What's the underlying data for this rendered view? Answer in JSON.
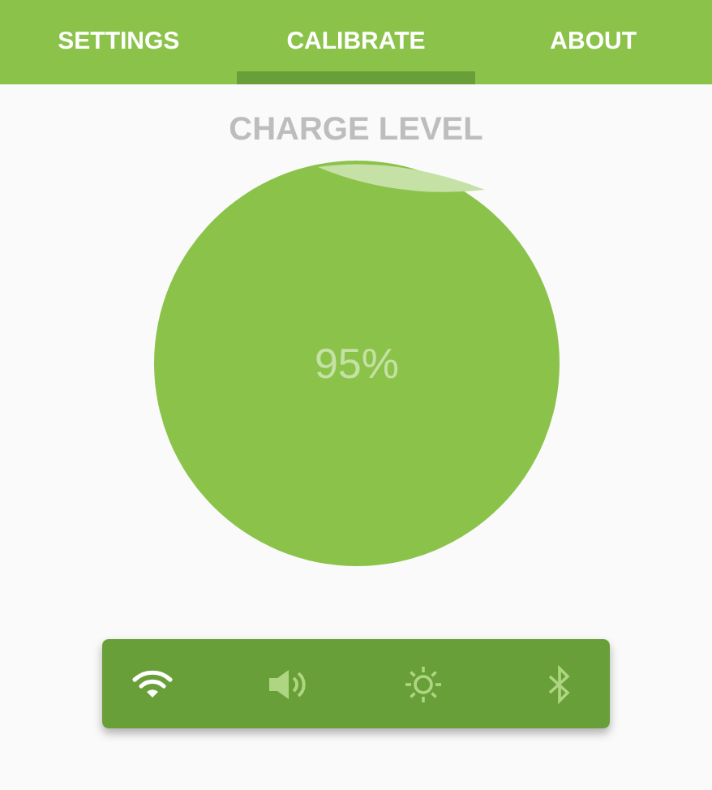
{
  "tabs": [
    {
      "label": "SETTINGS",
      "selected": false
    },
    {
      "label": "CALIBRATE",
      "selected": true
    },
    {
      "label": "ABOUT",
      "selected": false
    }
  ],
  "charge": {
    "title": "CHARGE LEVEL",
    "reading": "95%"
  },
  "toggles": [
    {
      "kind": "wifi",
      "on": true
    },
    {
      "kind": "sound",
      "on": false
    },
    {
      "kind": "brightness",
      "on": false
    },
    {
      "kind": "bluetooth",
      "on": false
    }
  ]
}
